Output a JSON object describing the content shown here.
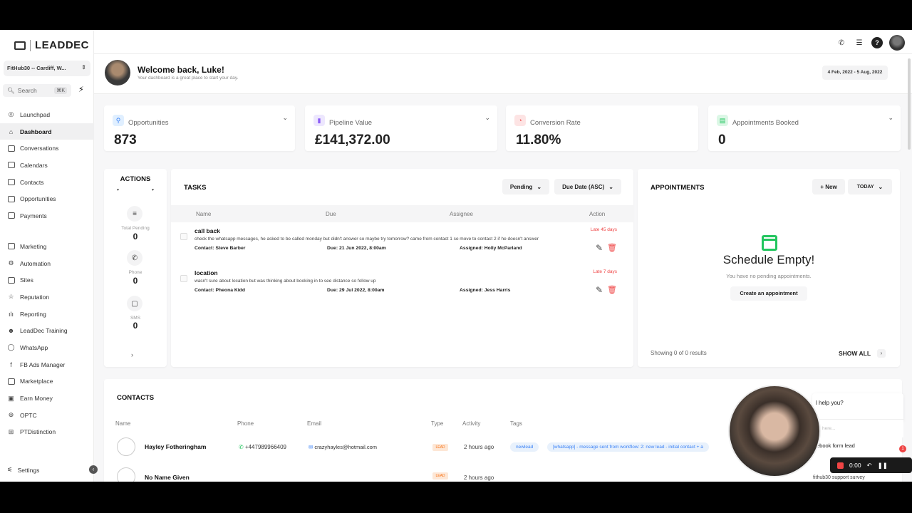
{
  "brand": {
    "name": "LEADDEC"
  },
  "location": {
    "value": "FitHub30 -- Cardiff, W..."
  },
  "search": {
    "label": "Search",
    "shortcut": "⌘K"
  },
  "sidebar": {
    "items": [
      {
        "label": "Launchpad",
        "icon": "rocket-icon"
      },
      {
        "label": "Dashboard",
        "icon": "dashboard-icon"
      },
      {
        "label": "Conversations",
        "icon": "chat-icon"
      },
      {
        "label": "Calendars",
        "icon": "calendar-icon"
      },
      {
        "label": "Contacts",
        "icon": "contacts-icon"
      },
      {
        "label": "Opportunities",
        "icon": "funnel-icon"
      },
      {
        "label": "Payments",
        "icon": "payments-icon"
      }
    ],
    "items2": [
      {
        "label": "Marketing",
        "icon": "megaphone-icon"
      },
      {
        "label": "Automation",
        "icon": "automation-icon"
      },
      {
        "label": "Sites",
        "icon": "globe-icon"
      },
      {
        "label": "Reputation",
        "icon": "star-icon"
      },
      {
        "label": "Reporting",
        "icon": "chart-icon"
      },
      {
        "label": "LeadDec Training",
        "icon": "users-icon"
      },
      {
        "label": "WhatsApp",
        "icon": "whatsapp-icon"
      },
      {
        "label": "FB Ads Manager",
        "icon": "facebook-icon"
      },
      {
        "label": "Marketplace",
        "icon": "store-icon"
      },
      {
        "label": "Earn Money",
        "icon": "money-icon"
      },
      {
        "label": "OPTC",
        "icon": "globe-icon"
      },
      {
        "label": "PTDistinction",
        "icon": "box-icon"
      }
    ],
    "settings": "Settings"
  },
  "welcome": {
    "title": "Welcome back, Luke!",
    "subtitle": "Your dashboard is a great place to start your day.",
    "date_range": "4 Feb, 2022 - 5 Aug, 2022"
  },
  "stats": [
    {
      "label": "Opportunities",
      "value": "873",
      "color": "#3b82f6"
    },
    {
      "label": "Pipeline Value",
      "value": "£141,372.00",
      "color": "#8b5cf6"
    },
    {
      "label": "Conversion Rate",
      "value": "11.80%",
      "color": "#ef4444"
    },
    {
      "label": "Appointments Booked",
      "value": "0",
      "color": "#22c55e"
    }
  ],
  "actions": {
    "title": "ACTIONS",
    "items": [
      {
        "label": "Total Pending",
        "value": "0"
      },
      {
        "label": "Phone",
        "value": "0"
      },
      {
        "label": "SMS",
        "value": "0"
      }
    ]
  },
  "tasks": {
    "title": "TASKS",
    "filter": "Pending",
    "sort": "Due Date (ASC)",
    "columns": [
      "Name",
      "Due",
      "Assignee",
      "Action"
    ],
    "rows": [
      {
        "name": "call back",
        "desc": "check the whatsapp messages, he asked to be called monday but didn't answer so maybe try tomorrow? came from contact 1 so move to contact 2 if he doesn't answer",
        "contact": "Contact: Steve Barber",
        "due": "Due: 21 Jun 2022, 8:00am",
        "assigned": "Assigned: Holly McParland",
        "late": "Late 45 days"
      },
      {
        "name": "location",
        "desc": "wasn't sure about location but was thinking about booking in to see distance so follow up",
        "contact": "Contact: Pheona Kidd",
        "due": "Due: 29 Jul 2022, 8:00am",
        "assigned": "Assigned: Jess Harris",
        "late": "Late 7 days"
      }
    ]
  },
  "appointments": {
    "title": "APPOINTMENTS",
    "new_label": "+ New",
    "range": "TODAY",
    "empty_title": "Schedule Empty!",
    "empty_sub": "You have no pending appointments.",
    "create_label": "Create an appointment",
    "showing": "Showing 0 of 0 results",
    "show_all": "SHOW ALL"
  },
  "contacts": {
    "title": "CONTACTS",
    "columns": [
      "Name",
      "Phone",
      "Email",
      "Type",
      "Activity",
      "Tags"
    ],
    "rows": [
      {
        "name": "Hayley Fotheringham",
        "phone": "+447989966409",
        "email": "crazyhayles@hotmail.com",
        "type": "LEAD",
        "activity": "2 hours ago",
        "tag1": "newlead",
        "tag2": "[whatsapp] - message sent from workflow: 2: new lead - initial contact + a"
      },
      {
        "name": "No Name Given",
        "phone": "",
        "email": "",
        "type": "LEAD",
        "activity": "2 hours ago",
        "tag1": "",
        "tag2": ""
      }
    ]
  },
  "chat_widget": {
    "greeting": "l help you?",
    "placeholder": "here...",
    "lead_source": "ebook form lead",
    "survey": "fithub30 support survey",
    "badge": "1"
  },
  "recorder": {
    "time": "0:00"
  }
}
